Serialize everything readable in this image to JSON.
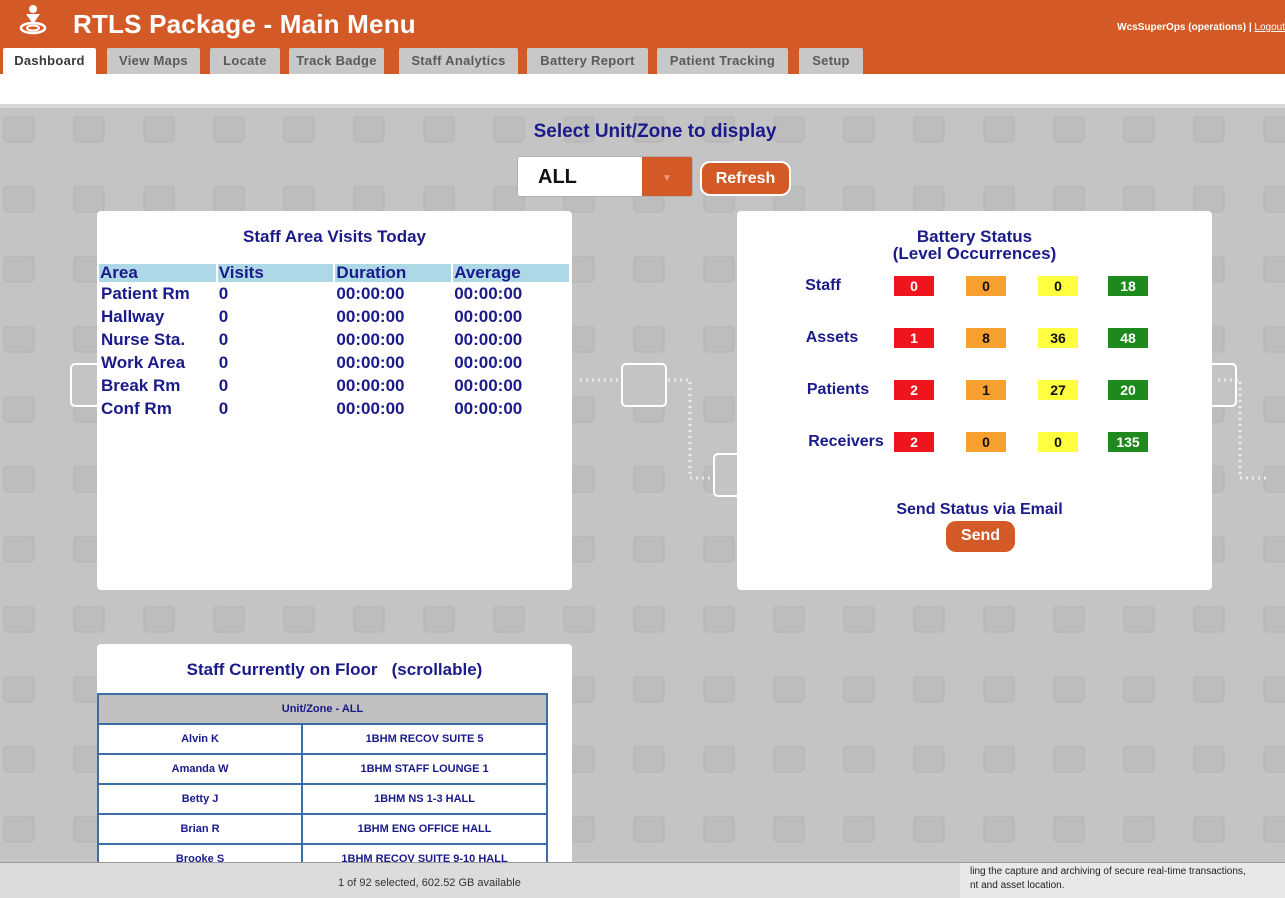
{
  "header": {
    "title": "RTLS Package - Main Menu",
    "user": "WcsSuperOps (operations)",
    "separator": " | ",
    "logout": "Logout"
  },
  "tabs": [
    {
      "label": "Dashboard",
      "active": true
    },
    {
      "label": "View Maps"
    },
    {
      "label": "Locate"
    },
    {
      "label": "Track Badge"
    },
    {
      "label": "Staff Analytics"
    },
    {
      "label": "Battery Report"
    },
    {
      "label": "Patient Tracking"
    },
    {
      "label": "Setup"
    }
  ],
  "selector": {
    "title": "Select Unit/Zone to display",
    "value": "ALL",
    "refresh_label": "Refresh"
  },
  "visits": {
    "title": "Staff Area Visits Today",
    "columns": [
      "Area",
      "Visits",
      "Duration",
      "Average"
    ],
    "rows": [
      [
        "Patient Rm",
        "0",
        "00:00:00",
        "00:00:00"
      ],
      [
        "Hallway",
        "0",
        "00:00:00",
        "00:00:00"
      ],
      [
        "Nurse Sta.",
        "0",
        "00:00:00",
        "00:00:00"
      ],
      [
        "Work Area",
        "0",
        "00:00:00",
        "00:00:00"
      ],
      [
        "Break Rm",
        "0",
        "00:00:00",
        "00:00:00"
      ],
      [
        "Conf Rm",
        "0",
        "00:00:00",
        "00:00:00"
      ]
    ]
  },
  "battery": {
    "title_line1": "Battery Status",
    "title_line2": "(Level Occurrences)",
    "rows": [
      {
        "label": "Staff",
        "values": [
          "0",
          "0",
          "0",
          "18"
        ]
      },
      {
        "label": "Assets",
        "values": [
          "1",
          "8",
          "36",
          "48"
        ]
      },
      {
        "label": "Patients",
        "values": [
          "2",
          "1",
          "27",
          "20"
        ]
      },
      {
        "label": "Receivers",
        "values": [
          "2",
          "0",
          "0",
          "135"
        ]
      }
    ],
    "level_colors": [
      "#f0141e",
      "#f7a030",
      "#ffff40",
      "#1e8a1e"
    ],
    "email_label": "Send Status via Email",
    "send_label": "Send"
  },
  "floor": {
    "title": "Staff Currently on Floor   (scrollable)",
    "header": "Unit/Zone - ALL",
    "rows": [
      [
        "Alvin K",
        "1BHM RECOV SUITE 5"
      ],
      [
        "Amanda W",
        "1BHM STAFF LOUNGE 1"
      ],
      [
        "Betty J",
        "1BHM NS 1-3 HALL"
      ],
      [
        "Brian R",
        "1BHM ENG OFFICE HALL"
      ],
      [
        "Brooke S",
        "1BHM RECOV SUITE 9-10 HALL"
      ]
    ]
  },
  "bottom": {
    "status": "1 of 92 selected, 602.52 GB available",
    "right_line1": "ling the capture and archiving of secure real-time transactions,",
    "right_line2": "nt and asset location."
  },
  "colors": {
    "brand": "#d35a26",
    "navy": "#1a1a8a",
    "table_header": "#add8e6"
  }
}
